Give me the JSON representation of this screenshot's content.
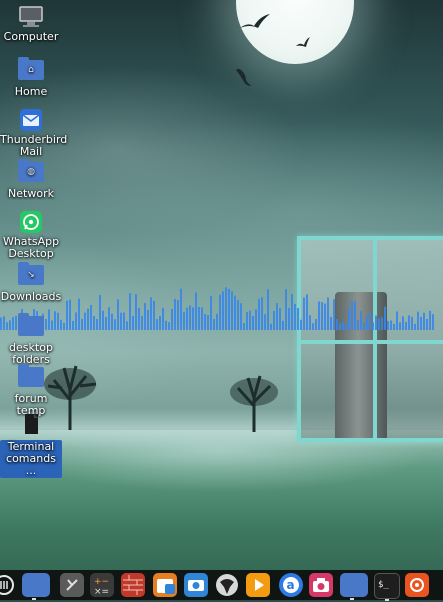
{
  "desktop": {
    "icons": [
      {
        "label": "Computer",
        "icon": "computer-icon"
      },
      {
        "label": "Home",
        "icon": "home-folder-icon"
      },
      {
        "label": "Thunderbird Mail",
        "icon": "thunderbird-mail-icon"
      },
      {
        "label": "Network",
        "icon": "network-folder-icon"
      },
      {
        "label": "WhatsApp Desktop",
        "icon": "whatsapp-icon"
      },
      {
        "label": "Downloads",
        "icon": "downloads-folder-icon"
      },
      {
        "label": "desktop folders",
        "icon": "folder-icon"
      },
      {
        "label": "forum temp",
        "icon": "folder-icon"
      },
      {
        "label": "Terminal comands ...",
        "icon": "text-file-icon",
        "selected": true
      }
    ]
  },
  "dock": {
    "items": [
      {
        "name": "menu-icon",
        "color": "#2a2a2a"
      },
      {
        "name": "file-manager-icon",
        "color": "#4a78c8"
      },
      {
        "name": "settings-icon",
        "color": "#555555"
      },
      {
        "name": "calculator-icon",
        "color": "#3a3a3a"
      },
      {
        "name": "firewall-icon",
        "color": "#c0392b"
      },
      {
        "name": "software-center-icon",
        "color": "#e67e22"
      },
      {
        "name": "screenshot-icon",
        "color": "#2f86d6"
      },
      {
        "name": "inkscape-icon",
        "color": "#cfcfcf"
      },
      {
        "name": "media-player-icon",
        "color": "#f39c12"
      },
      {
        "name": "amazon-icon",
        "color": "#2c7be5"
      },
      {
        "name": "camera-icon",
        "color": "#d63868"
      },
      {
        "name": "folder-icon",
        "color": "#4a78c8"
      },
      {
        "name": "terminal-icon",
        "color": "#222222"
      },
      {
        "name": "ubuntu-icon",
        "color": "#e95420"
      }
    ]
  },
  "colors": {
    "accent": "#2a63b7",
    "visualizer_bar": "#3a86e8",
    "window_frame": "#7fd7cf"
  }
}
